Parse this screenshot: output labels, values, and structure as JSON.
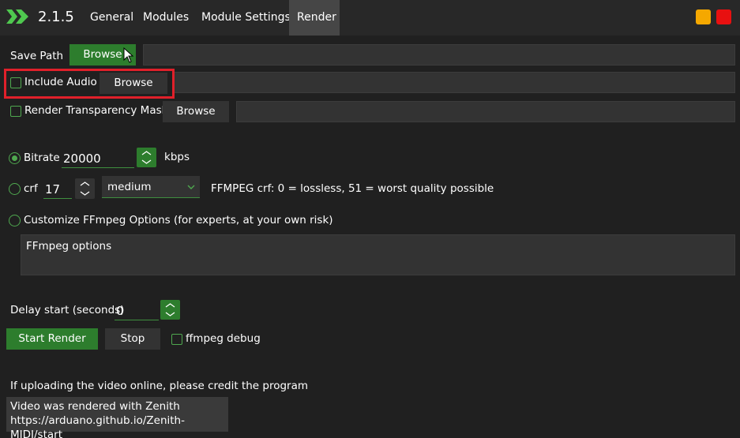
{
  "app": {
    "version": "2.1.5",
    "tabs": [
      "General",
      "Modules",
      "Module Settings",
      "Render"
    ],
    "active_tab": "Render",
    "colors": {
      "accent": "#2d7d2d",
      "minimize": "#f5a800",
      "close": "#e81010",
      "highlight": "#e0202a"
    }
  },
  "save_path": {
    "label": "Save Path",
    "browse_label": "Browse",
    "value": ""
  },
  "include_audio": {
    "label": "Include Audio",
    "checked": false,
    "browse_label": "Browse",
    "value": ""
  },
  "transparency_mask": {
    "label": "Render Transparency Mask",
    "checked": false,
    "browse_label": "Browse",
    "value": ""
  },
  "bitrate": {
    "label": "Bitrate",
    "value": "20000",
    "unit": "kbps",
    "selected": true
  },
  "crf": {
    "label": "crf",
    "value": "17",
    "preset": "medium",
    "note": "FFMPEG crf: 0 = lossless, 51 = worst quality possible",
    "selected": false
  },
  "custom_ffmpeg": {
    "label": "Customize FFmpeg Options (for experts, at your own risk)",
    "placeholder": "FFmpeg options",
    "selected": false
  },
  "delay": {
    "label": "Delay start (seconds)",
    "value": "0"
  },
  "actions": {
    "start_label": "Start Render",
    "stop_label": "Stop",
    "debug_label": "ffmpeg debug",
    "debug_checked": false
  },
  "credit": {
    "prompt": "If uploading the video online, please credit the program",
    "line1": "Video was rendered with Zenith",
    "line2": "https://arduano.github.io/Zenith-MIDI/start"
  }
}
